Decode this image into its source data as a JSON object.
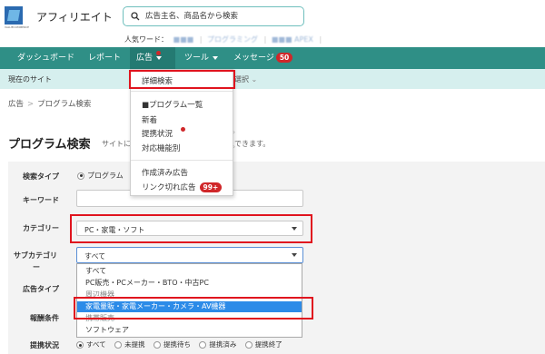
{
  "header": {
    "app_title": "アフィリエイト",
    "logo_tagline": "VALUECOMMERCE",
    "search_placeholder": "広告主名、商品名から検索",
    "popular_label": "人気ワード：",
    "popular_words": [
      "■■■",
      "プログラミング",
      "■■■ APEX"
    ]
  },
  "nav": {
    "items": [
      {
        "label": "ダッシュボード"
      },
      {
        "label": "レポート"
      },
      {
        "label": "広告"
      },
      {
        "label": "ツール"
      },
      {
        "label": "メッセージ"
      }
    ],
    "message_badge": "50"
  },
  "subbar": {
    "current_site": "現在のサイト",
    "select_label": "選択"
  },
  "breadcrumb": {
    "root": "広告",
    "separator": ">",
    "current": "プログラム検索"
  },
  "page": {
    "title": "プログラム検索",
    "description_start": "サイトに",
    "description_end": "できます。"
  },
  "menu": {
    "items": [
      {
        "label": "詳細検索"
      },
      {
        "label": "■プログラム一覧"
      },
      {
        "label": "新着"
      },
      {
        "label": "提携状況"
      },
      {
        "label": "対応機能別"
      },
      {
        "label": "作成済み広告"
      },
      {
        "label": "リンク切れ広告"
      }
    ],
    "link_broken_badge": "99+",
    "chevron": "›"
  },
  "form": {
    "search_type": {
      "label": "検索タイプ",
      "option": "プログラム"
    },
    "keyword": {
      "label": "キーワード",
      "value": ""
    },
    "category": {
      "label": "カテゴリー",
      "value": "PC・家電・ソフト"
    },
    "subcategory": {
      "label_line1": "サブカテゴリ",
      "label_line2": "ー",
      "value": "すべて",
      "options": [
        "すべて",
        "PC販売・PCメーカー・BTO・中古PC",
        "周辺機器",
        "家電量販・家電メーカー・カメラ・AV機器",
        "携帯販売",
        "ソフトウェア"
      ],
      "highlighted_index": 3
    },
    "ad_type": {
      "label": "広告タイプ"
    },
    "reward": {
      "label": "報酬条件"
    },
    "status": {
      "label": "提携状況",
      "options": [
        "すべて",
        "未提携",
        "提携待ち",
        "提携済み",
        "提携終了"
      ]
    }
  },
  "colors": {
    "nav_bg": "#2f8f86",
    "subbar_bg": "#d6efee",
    "badge": "#d0272a",
    "highlight": "#e0141e",
    "option_highlight": "#2c8be8"
  }
}
